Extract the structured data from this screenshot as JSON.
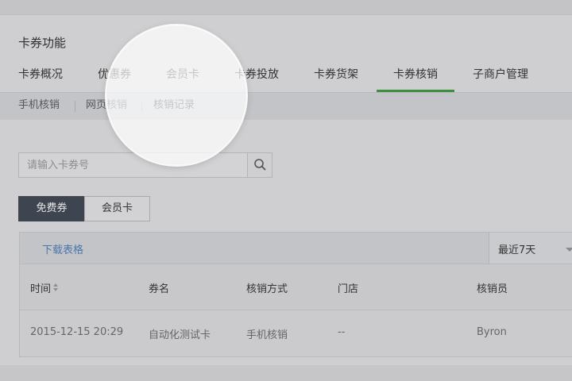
{
  "section_title": "卡券功能",
  "tabs": [
    {
      "label": "卡券概况"
    },
    {
      "label": "优惠券"
    },
    {
      "label": "会员卡"
    },
    {
      "label": "卡券投放"
    },
    {
      "label": "卡券货架"
    },
    {
      "label": "卡券核销",
      "active": true
    },
    {
      "label": "子商户管理"
    }
  ],
  "subtabs": [
    {
      "label": "手机核销"
    },
    {
      "label": "网页核销"
    },
    {
      "label": "核销记录",
      "current": true
    }
  ],
  "search": {
    "placeholder": "请输入卡券号",
    "icon": "search-icon"
  },
  "type_toggle": {
    "active_label": "免费券",
    "inactive_label": "会员卡"
  },
  "table": {
    "download_label": "下载表格",
    "range_value": "最近7天",
    "columns": [
      "时间",
      "券名",
      "核销方式",
      "门店",
      "核销员"
    ],
    "rows": [
      {
        "time": "2015-12-15 20:29",
        "name": "自动化测试卡",
        "method": "手机核销",
        "store": "--",
        "operator": "Byron"
      }
    ]
  },
  "colors": {
    "accent_tab": "#3b8f3f",
    "link": "#4b78a8",
    "active_button": "#3e4550"
  }
}
